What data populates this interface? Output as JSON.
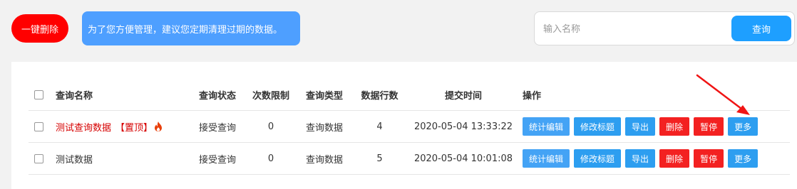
{
  "toolbar": {
    "delete_all_label": "一键删除",
    "tip_text": "为了您方便管理，建议您定期清理过期的数据。"
  },
  "search": {
    "placeholder": "输入名称",
    "value": "",
    "button_label": "查询"
  },
  "table": {
    "columns": [
      "查询名称",
      "查询状态",
      "次数限制",
      "查询类型",
      "数据行数",
      "提交时间",
      "操作"
    ],
    "rows": [
      {
        "name": "测试查询数据",
        "pin_tag": "【置顶】",
        "status": "接受查询",
        "limit": "0",
        "type": "查询数据",
        "rows_count": "4",
        "submitted": "2020-05-04 13:33:22",
        "actions": [
          "统计编辑",
          "修改标题",
          "导出",
          "删除",
          "暂停",
          "更多"
        ]
      },
      {
        "name": "测试数据",
        "status": "接受查询",
        "limit": "0",
        "type": "查询数据",
        "rows_count": "5",
        "submitted": "2020-05-04 10:01:08",
        "actions": [
          "统计编辑",
          "修改标题",
          "导出",
          "删除",
          "暂停",
          "更多"
        ]
      }
    ]
  },
  "icons": {
    "pinned": "flame-icon",
    "annotation": "red-arrow-icon"
  },
  "colors": {
    "danger": "#ff0000",
    "primary": "#1e9fff",
    "tip": "#4e9fff",
    "pinned_text": "#d60000"
  }
}
